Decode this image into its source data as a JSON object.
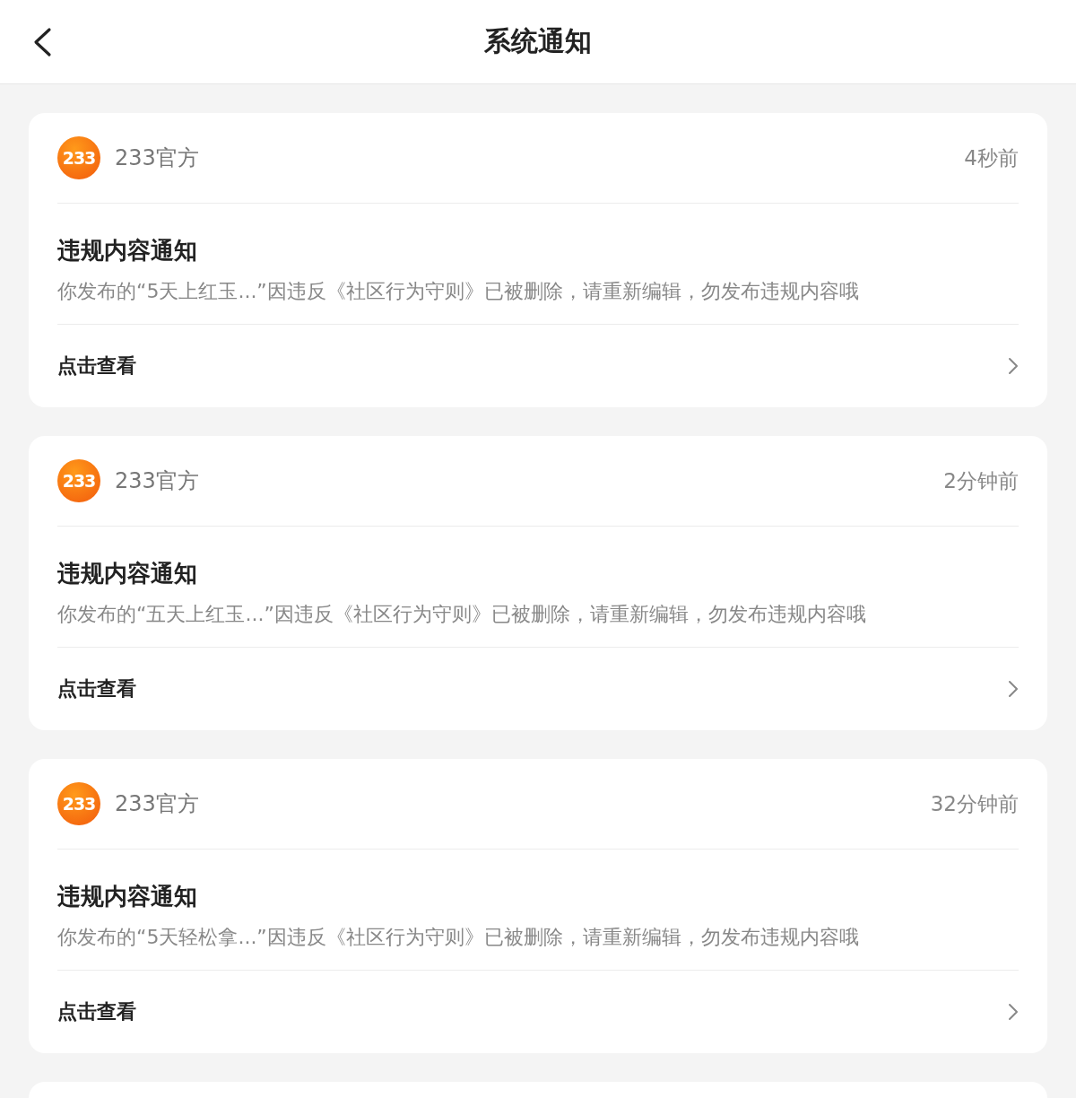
{
  "header": {
    "title": "系统通知"
  },
  "notifications": [
    {
      "logo_text": "233",
      "sender": "233官方",
      "time": "4秒前",
      "title": "违规内容通知",
      "body": "你发布的“5天上红玉...”因违反《社区行为守则》已被删除，请重新编辑，勿发布违规内容哦",
      "action": "点击查看"
    },
    {
      "logo_text": "233",
      "sender": "233官方",
      "time": "2分钟前",
      "title": "违规内容通知",
      "body": "你发布的“五天上红玉...”因违反《社区行为守则》已被删除，请重新编辑，勿发布违规内容哦",
      "action": "点击查看"
    },
    {
      "logo_text": "233",
      "sender": "233官方",
      "time": "32分钟前",
      "title": "违规内容通知",
      "body": "你发布的“5天轻松拿...”因违反《社区行为守则》已被删除，请重新编辑，勿发布违规内容哦",
      "action": "点击查看"
    }
  ]
}
